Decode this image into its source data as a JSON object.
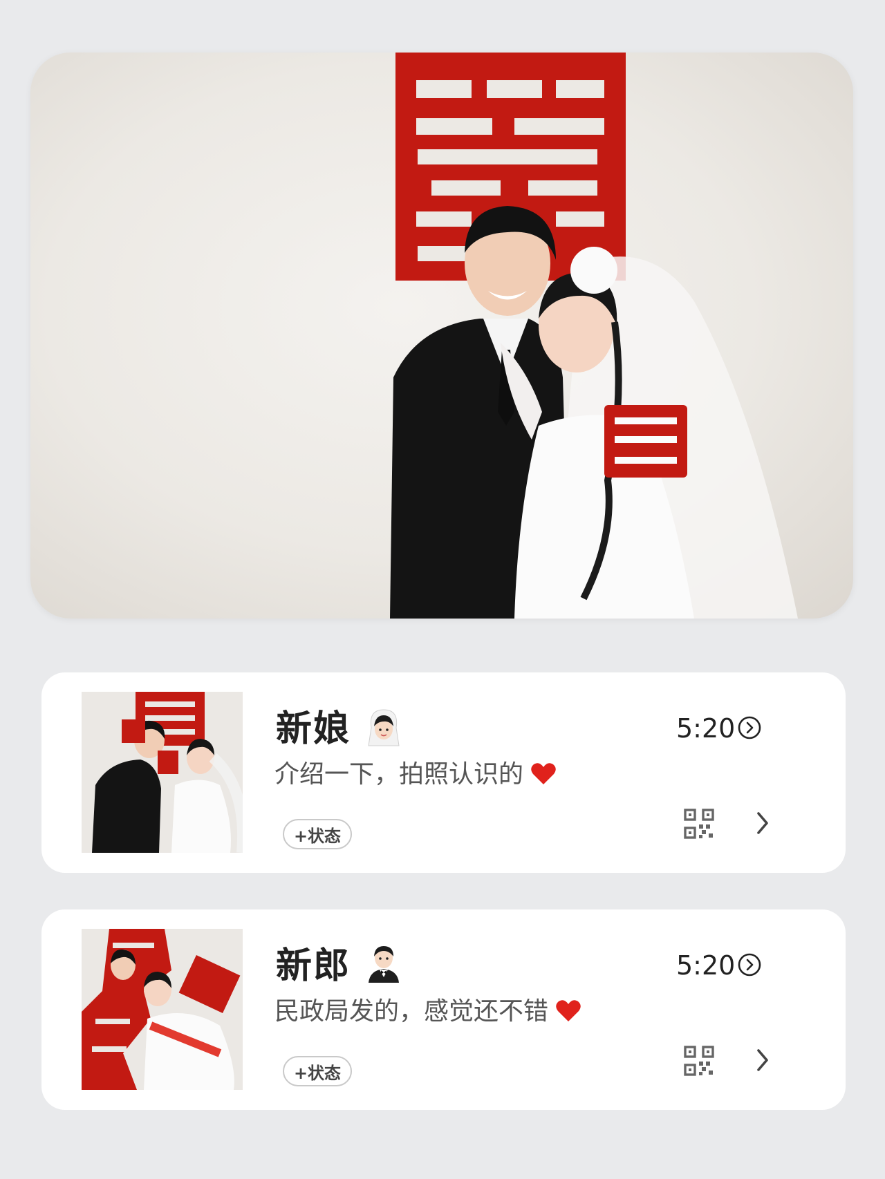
{
  "contacts": [
    {
      "name": "新娘",
      "role_icon": "bride-emoji-icon",
      "status_text": "介绍一下，拍照认识的",
      "status_emoji": "red-heart-icon",
      "time": "5:20",
      "add_status_label": "+状态"
    },
    {
      "name": "新郎",
      "role_icon": "groom-emoji-icon",
      "status_text": "民政局发的，感觉还不错",
      "status_emoji": "red-heart-icon",
      "time": "5:20",
      "add_status_label": "+状态"
    }
  ],
  "colors": {
    "background": "#e9eaec",
    "accent_red": "#c21a12",
    "card": "#ffffff"
  }
}
